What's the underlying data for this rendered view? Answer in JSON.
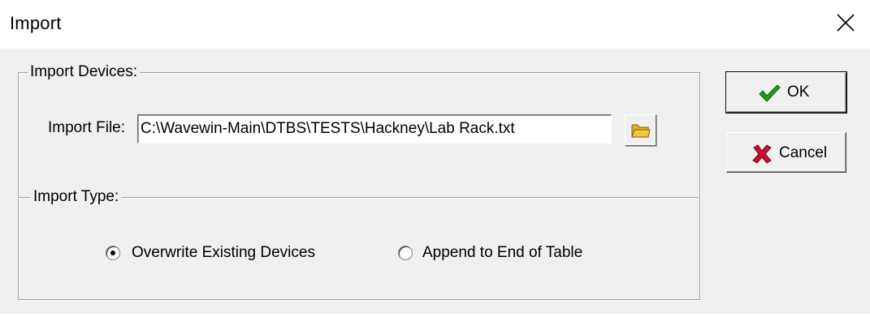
{
  "window": {
    "title": "Import",
    "close_icon": "close-icon"
  },
  "import_devices": {
    "group_label": "Import Devices:",
    "file_label": "Import File:",
    "file_value": "C:\\Wavewin-Main\\DTBS\\TESTS\\Hackney\\Lab Rack.txt",
    "browse_icon": "folder-icon"
  },
  "import_type": {
    "group_label": "Import Type:",
    "options": [
      {
        "label": "Overwrite Existing Devices",
        "selected": true
      },
      {
        "label": "Append to End of Table",
        "selected": false
      }
    ]
  },
  "buttons": {
    "ok_label": "OK",
    "ok_icon": "checkmark-icon",
    "cancel_label": "Cancel",
    "cancel_icon": "x-icon"
  },
  "colors": {
    "check_green": "#1e9e1e",
    "cancel_red": "#c8102e",
    "folder_yellow": "#f5c542"
  }
}
